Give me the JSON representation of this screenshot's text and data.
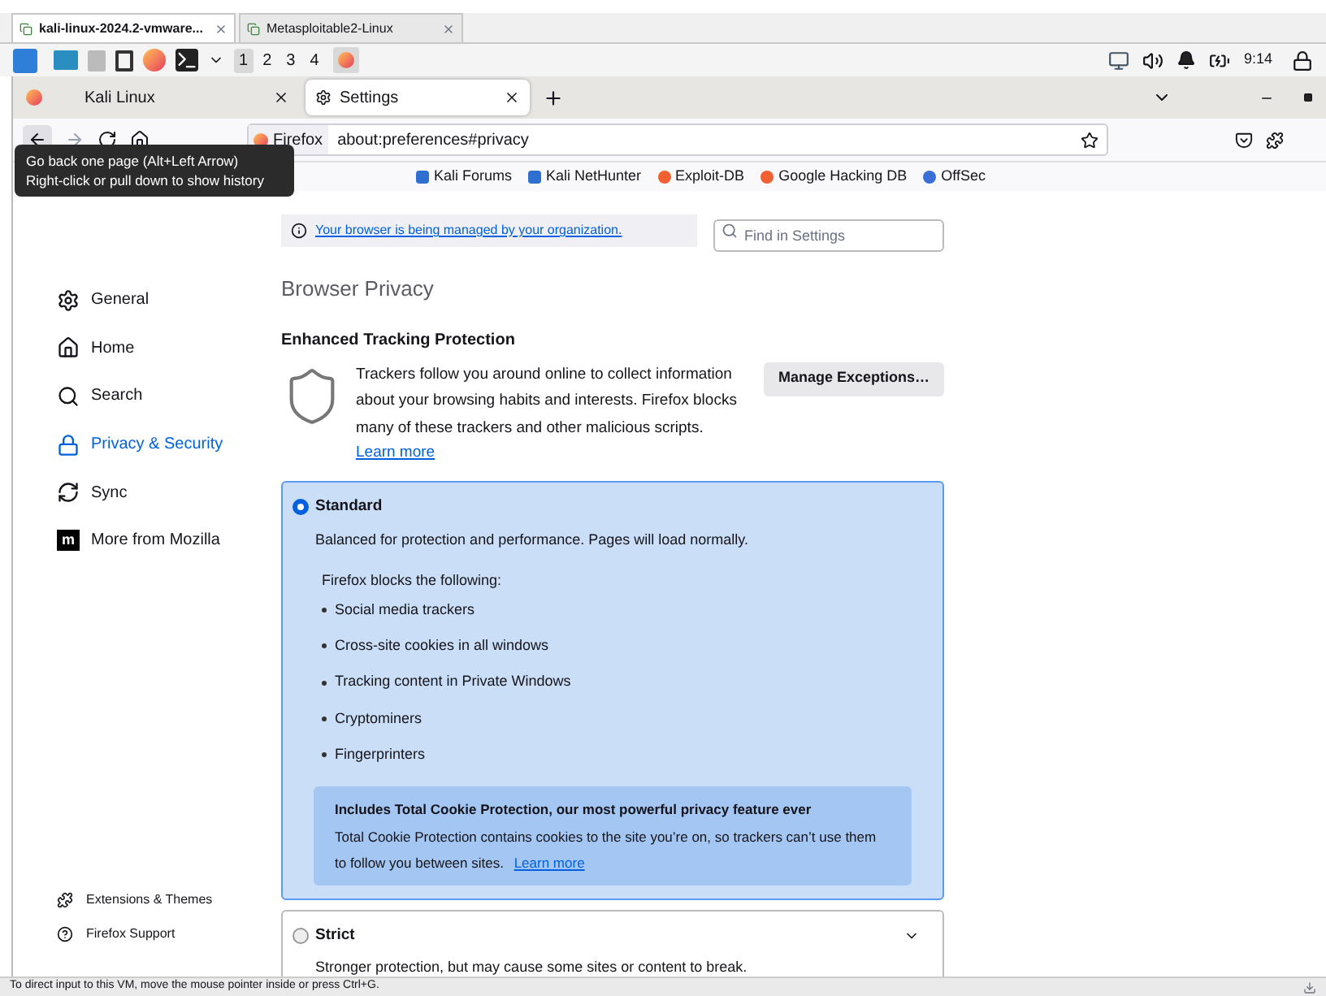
{
  "vm_tabs": [
    {
      "label": "kali-linux-2024.2-vmware...",
      "selected": true
    },
    {
      "label": "Metasploitable2-Linux",
      "selected": false
    }
  ],
  "panel": {
    "workspaces": [
      {
        "label": "1",
        "selected": true
      },
      {
        "label": "2",
        "selected": false
      },
      {
        "label": "3",
        "selected": false
      },
      {
        "label": "4",
        "selected": false
      }
    ],
    "clock": "9:14"
  },
  "browser_tabs": [
    {
      "label": "Kali Linux",
      "selected": false
    },
    {
      "label": "Settings",
      "selected": true
    }
  ],
  "address_bar": {
    "identity": "Firefox",
    "url": "about:preferences#privacy"
  },
  "tooltip": [
    "Go back one page (Alt+Left Arrow)",
    "Right-click or pull down to show history"
  ],
  "bookmarks": [
    {
      "label": "Kali Forums"
    },
    {
      "label": "Kali NetHunter"
    },
    {
      "label": "Exploit-DB"
    },
    {
      "label": "Google Hacking DB"
    },
    {
      "label": "OffSec"
    }
  ],
  "managed_notice": "Your browser is being managed by your organization.",
  "search": {
    "placeholder": "Find in Settings"
  },
  "sidebar": {
    "items": [
      {
        "label": "General",
        "selected": false
      },
      {
        "label": "Home",
        "selected": false
      },
      {
        "label": "Search",
        "selected": false
      },
      {
        "label": "Privacy & Security",
        "selected": true
      },
      {
        "label": "Sync",
        "selected": false
      },
      {
        "label": "More from Mozilla",
        "selected": false,
        "logo": "m"
      }
    ],
    "footer": [
      "Extensions & Themes",
      "Firefox Support"
    ]
  },
  "content": {
    "heading": "Browser Privacy",
    "etp_title": "Enhanced Tracking Protection",
    "etp_text": "Trackers follow you around online to collect information about your browsing habits and interests. Firefox blocks many of these trackers and other malicious scripts.",
    "learn_more": "Learn more",
    "manage_button": "Manage Exceptions…",
    "options": [
      {
        "label": "Standard",
        "selected": true,
        "description": "Balanced for protection and performance. Pages will load normally.",
        "blocks_title": "Firefox blocks the following:",
        "blocks": [
          "Social media trackers",
          "Cross-site cookies in all windows",
          "Tracking content in Private Windows",
          "Cryptominers",
          "Fingerprinters"
        ],
        "callout": {
          "title": "Includes Total Cookie Protection, our most powerful privacy feature ever",
          "text": "Total Cookie Protection contains cookies to the site you’re on, so trackers can’t use them to follow you between sites.",
          "link": "Learn more"
        }
      },
      {
        "label": "Strict",
        "selected": false,
        "description": "Stronger protection, but may cause some sites or content to break."
      }
    ]
  },
  "status_bar": "To direct input to this VM, move the mouse pointer inside or press Ctrl+G."
}
